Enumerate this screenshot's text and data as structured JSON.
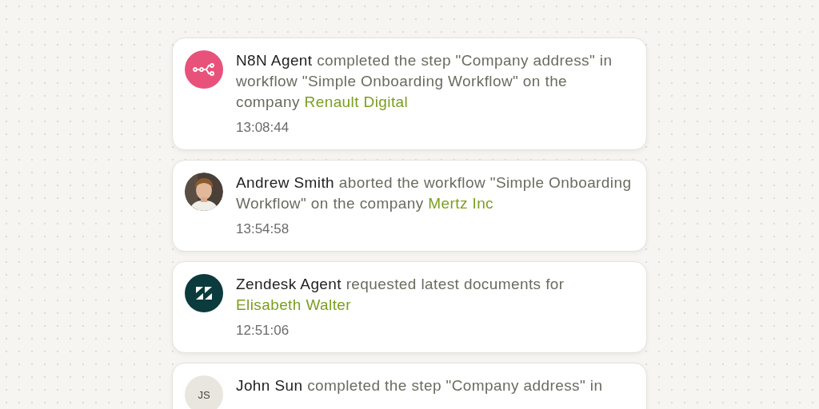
{
  "activities": [
    {
      "avatar": {
        "kind": "workflow-logo",
        "color": "#e8527a"
      },
      "actor": "N8N Agent",
      "action": " completed the step \"Company address\" in workflow \"Simple Onboarding Workflow\" on the company ",
      "target": "Renault Digital",
      "time": "13:08:44"
    },
    {
      "actor": "Andrew Smith",
      "action": " aborted the workflow \"Simple Onboarding Workflow\" on the company ",
      "target": "Mertz Inc",
      "time": "13:54:58"
    },
    {
      "avatar": {
        "kind": "z-logo",
        "color": "#0b3b3c"
      },
      "actor": "Zendesk Agent",
      "action": " requested latest documents for ",
      "target": "Elisabeth Walter",
      "time": "12:51:06"
    },
    {
      "avatar": {
        "kind": "initials",
        "color": "#e9e6df",
        "initials": "JS"
      },
      "actor": "John Sun",
      "action": " completed the step \"Company address\" in"
    }
  ]
}
